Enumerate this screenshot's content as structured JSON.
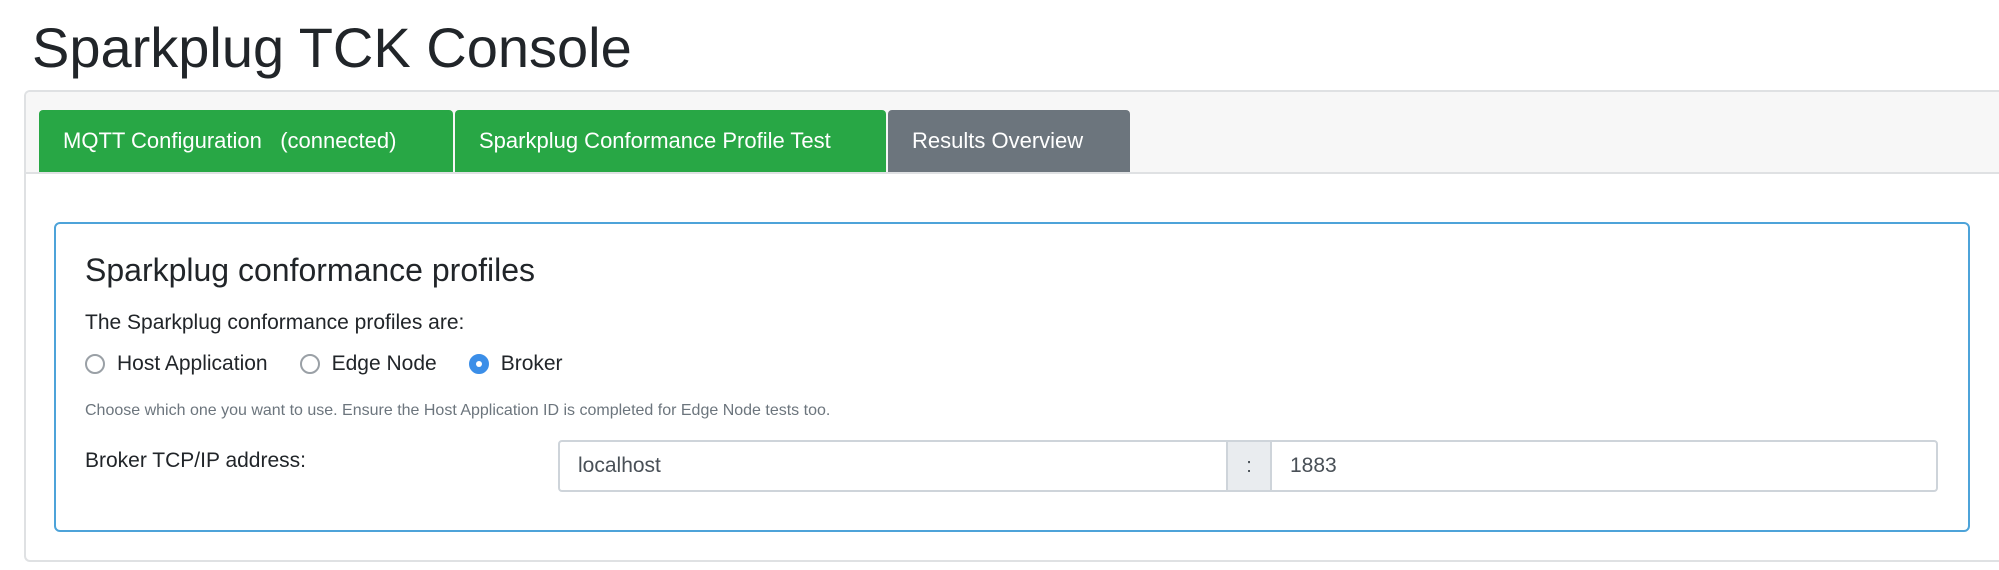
{
  "app": {
    "title": "Sparkplug TCK Console"
  },
  "tabs": [
    {
      "label": "MQTT Configuration   (connected)",
      "state": "success"
    },
    {
      "label": "Sparkplug Conformance Profile Test",
      "state": "success"
    },
    {
      "label": "Results Overview",
      "state": "secondary"
    }
  ],
  "profiles": {
    "heading": "Sparkplug conformance profiles",
    "intro": "The Sparkplug conformance profiles are:",
    "options": [
      {
        "label": "Host Application",
        "checked": false
      },
      {
        "label": "Edge Node",
        "checked": false
      },
      {
        "label": "Broker",
        "checked": true
      }
    ],
    "help": "Choose which one you want to use. Ensure the Host Application ID is completed for Edge Node tests too.",
    "broker": {
      "label": "Broker TCP/IP address:",
      "host_value": "localhost",
      "separator": ":",
      "port_value": "1883"
    }
  },
  "colors": {
    "tab_success": "#28a745",
    "tab_secondary": "#6c757d",
    "panel_border": "#4da3d9",
    "radio_checked": "#3b8ee8"
  }
}
